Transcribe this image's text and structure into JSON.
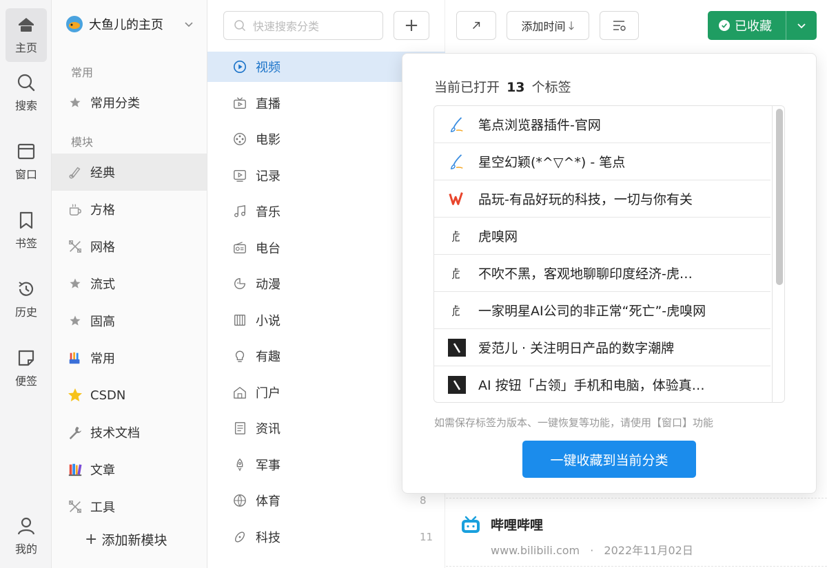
{
  "rail": {
    "items": [
      {
        "label": "主页",
        "icon": "home-icon",
        "active": true
      },
      {
        "label": "搜索",
        "icon": "search-icon"
      },
      {
        "label": "窗口",
        "icon": "window-icon"
      },
      {
        "label": "书签",
        "icon": "bookmark-icon"
      },
      {
        "label": "历史",
        "icon": "history-icon"
      },
      {
        "label": "便签",
        "icon": "note-icon"
      },
      {
        "label": "我的",
        "icon": "user-icon"
      }
    ]
  },
  "modules": {
    "home_title": "大鱼儿的主页",
    "section_common": "常用",
    "section_modules": "模块",
    "common_items": [
      {
        "label": "常用分类",
        "icon": "star-icon"
      }
    ],
    "items": [
      {
        "label": "经典",
        "icon": "brush-icon",
        "active": true
      },
      {
        "label": "方格",
        "icon": "cup-icon"
      },
      {
        "label": "网格",
        "icon": "tools-icon"
      },
      {
        "label": "流式",
        "icon": "star-icon"
      },
      {
        "label": "固高",
        "icon": "star-icon"
      },
      {
        "label": "常用",
        "icon": "pencils-icon"
      },
      {
        "label": "CSDN",
        "icon": "gold-star-icon"
      },
      {
        "label": "技术文档",
        "icon": "wrench-icon"
      },
      {
        "label": "文章",
        "icon": "books-icon"
      },
      {
        "label": "工具",
        "icon": "tools-icon"
      }
    ],
    "add_label": "添加新模块"
  },
  "categories": {
    "search_placeholder": "快速搜索分类",
    "items": [
      {
        "label": "视频",
        "icon": "play-icon",
        "active": true
      },
      {
        "label": "直播",
        "icon": "tv-icon"
      },
      {
        "label": "电影",
        "icon": "film-reel-icon"
      },
      {
        "label": "记录",
        "icon": "video-record-icon"
      },
      {
        "label": "音乐",
        "icon": "music-icon"
      },
      {
        "label": "电台",
        "icon": "radio-icon"
      },
      {
        "label": "动漫",
        "icon": "anime-icon"
      },
      {
        "label": "小说",
        "icon": "book-icon"
      },
      {
        "label": "有趣",
        "icon": "bulb-icon"
      },
      {
        "label": "门户",
        "icon": "house-icon"
      },
      {
        "label": "资讯",
        "icon": "news-icon"
      },
      {
        "label": "军事",
        "icon": "rocket-icon"
      },
      {
        "label": "体育",
        "icon": "ball-icon"
      },
      {
        "label": "科技",
        "icon": "tech-icon"
      }
    ],
    "counts": [
      {
        "value": "8"
      },
      {
        "value": "11"
      }
    ]
  },
  "toolbar": {
    "sort_label": "添加时间",
    "saved_label": "已收藏",
    "accent": "#1f9d62"
  },
  "popup": {
    "head_prefix": "当前已打开",
    "tab_count": "13",
    "head_suffix": "个标签",
    "tabs": [
      {
        "title": "笔点浏览器插件-官网",
        "icon": "brush-favicon"
      },
      {
        "title": "星空幻颖(*^▽^*) - 笔点",
        "icon": "brush-favicon"
      },
      {
        "title": "品玩-有品好玩的科技，一切与你有关",
        "icon": "pingwest-favicon"
      },
      {
        "title": "虎嗅网",
        "icon": "huxiu-favicon"
      },
      {
        "title": "不吹不黑，客观地聊聊印度经济-虎…",
        "icon": "huxiu-favicon"
      },
      {
        "title": "一家明星AI公司的非正常“死亡”-虎嗅网",
        "icon": "huxiu-favicon"
      },
      {
        "title": "爱范儿 · 关注明日产品的数字潮牌",
        "icon": "ifanr-favicon"
      },
      {
        "title": "AI 按钮「占领」手机和电脑，体验真…",
        "icon": "ifanr-favicon"
      }
    ],
    "note": "如需保存标签为版本、一键恢复等功能，请使用【窗口】功能",
    "button_label": "一键收藏到当前分类",
    "button_color": "#1b8cec"
  },
  "bookmark": {
    "title": "哔哩哔哩",
    "url": "www.bilibili.com",
    "separator": "·",
    "date": "2022年11月02日"
  }
}
